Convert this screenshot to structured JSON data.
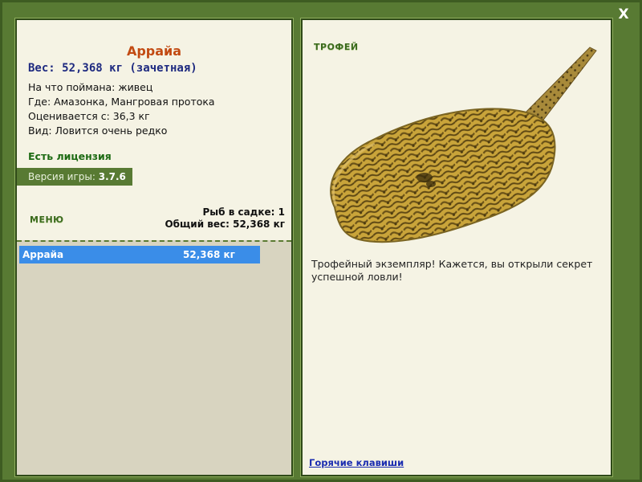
{
  "window": {
    "close_label": "X"
  },
  "fish": {
    "name": "Аррайа",
    "weight_line": "Вес: 52,368 кг (зачетная)",
    "bait_line": "На что поймана: живец",
    "location_line": "Где: Амазонка, Мангровая протока",
    "threshold_line": "Оценивается с: 36,3 кг",
    "rarity_line": "Вид: Ловится очень редко"
  },
  "license": "Есть лицензия",
  "version": {
    "label": "Версия игры: ",
    "value": "3.7.6"
  },
  "menu_label": "МЕНЮ",
  "stats": {
    "count_line": "Рыб в садке: 1",
    "total_line": "Общий вес: 52,368 кг"
  },
  "keepnet": [
    {
      "name": "Аррайа",
      "weight": "52,368 кг"
    }
  ],
  "trophy": {
    "label": "ТРОФЕЙ",
    "message": "Трофейный экземпляр! Кажется, вы открыли секрет успешной ловли!",
    "image_icon": "stingray-image"
  },
  "hotkeys_link": "Горячие клавиши",
  "colors": {
    "frame": "#587a33",
    "panel_bg": "#f5f3e4",
    "accent_title": "#c24a12",
    "selection": "#3a8de8"
  }
}
